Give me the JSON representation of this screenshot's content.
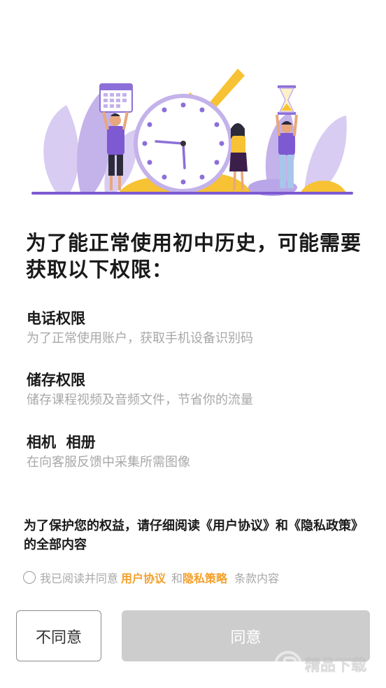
{
  "dialog": {
    "title": "为了能正常使用初中历史，可能需要获取以下权限："
  },
  "permissions": [
    {
      "name": "电话权限",
      "desc": "为了正常使用账户，获取手机设备识别码"
    },
    {
      "name": "储存权限",
      "desc": "储存课程视频及音频文件，节省你的流量"
    },
    {
      "name": "相机  相册",
      "desc": "在向客服反馈中采集所需图像"
    }
  ],
  "notice": "为了保护您的权益，请仔细阅读《用户协议》和《隐私政策》的全部内容",
  "agreement": {
    "prefix": "我已阅读并同意",
    "user_agreement": "用户协议",
    "and": "和",
    "privacy_policy": "隐私策略",
    "suffix": "条款内容"
  },
  "buttons": {
    "decline": "不同意",
    "agree": "同意"
  },
  "colors": {
    "accent": "#f4a02a",
    "illustration_purple": "#a98fe0",
    "illustration_yellow": "#f7c233",
    "disabled_button": "#cdcdcd"
  },
  "watermark": {
    "text": "精品下载"
  },
  "illustration": {
    "icon": "clock-people-illustration"
  }
}
